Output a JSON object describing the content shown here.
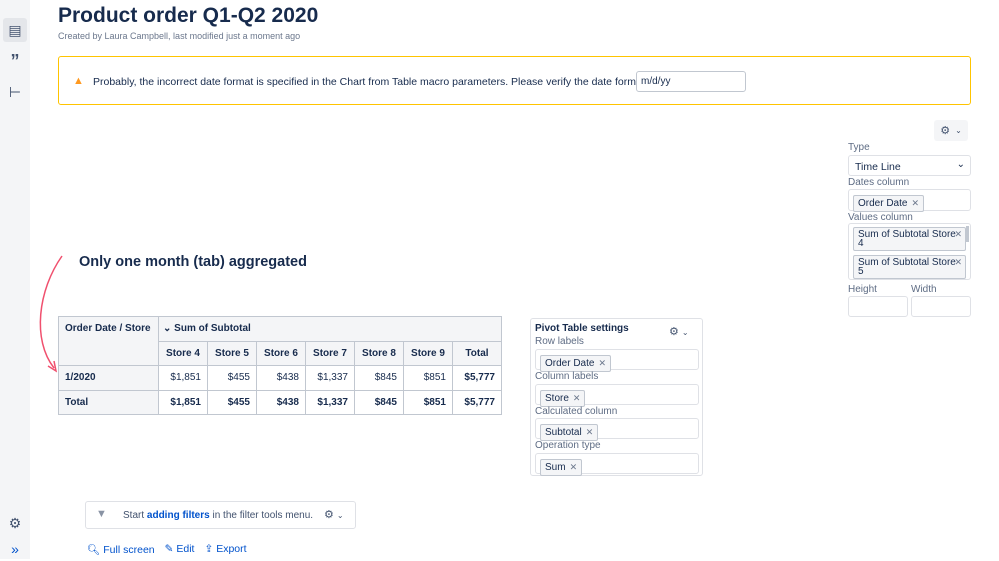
{
  "sidebar": {
    "icons": [
      "page-icon",
      "quote-icon",
      "tree-icon",
      "settings-icon",
      "expand-icon"
    ]
  },
  "page": {
    "title": "Product order Q1-Q2 2020",
    "byline": "Created by Laura Campbell, last modified just a moment ago"
  },
  "warning": {
    "message": "Probably, the incorrect date format is specified in the Chart from Table macro parameters. Please verify the date format:",
    "date_format": "m/d/yy"
  },
  "chart_settings": {
    "type_label": "Type",
    "type_value": "Time Line",
    "dates_label": "Dates column",
    "dates_chip": "Order Date",
    "values_label": "Values column",
    "values_chips": [
      "Sum of Subtotal Store 4",
      "Sum of Subtotal Store 5"
    ],
    "height_label": "Height",
    "width_label": "Width"
  },
  "annotation": "Only one month (tab) aggregated",
  "table": {
    "corner": "Order Date / Store",
    "group": "Sum of Subtotal",
    "columns": [
      "Store 4",
      "Store 5",
      "Store 6",
      "Store 7",
      "Store 8",
      "Store 9",
      "Total"
    ],
    "rows": [
      {
        "label": "1/2020",
        "values": [
          "$1,851",
          "$455",
          "$438",
          "$1,337",
          "$845",
          "$851",
          "$5,777"
        ]
      },
      {
        "label": "Total",
        "values": [
          "$1,851",
          "$455",
          "$438",
          "$1,337",
          "$845",
          "$851",
          "$5,777"
        ]
      }
    ]
  },
  "pivot": {
    "title": "Pivot Table settings",
    "row_label": "Row labels",
    "row_chip": "Order Date",
    "col_label": "Column labels",
    "col_chip": "Store",
    "calc_label": "Calculated column",
    "calc_chip": "Subtotal",
    "op_label": "Operation type",
    "op_chip": "Sum"
  },
  "filter": {
    "prefix": "Start ",
    "link": "adding filters",
    "suffix": " in the filter tools menu."
  },
  "links": {
    "fullscreen": "Full screen",
    "edit": "Edit",
    "export": "Export"
  },
  "colors": {
    "accent": "#0052cc",
    "warning_border": "#ffc400",
    "arrow": "#f0506e"
  }
}
